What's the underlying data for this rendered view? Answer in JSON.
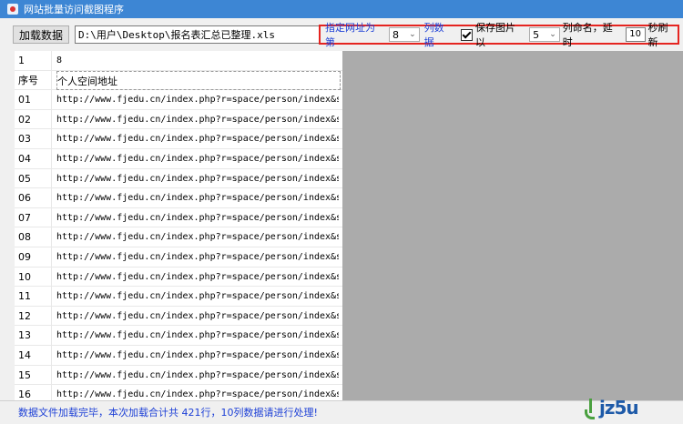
{
  "window": {
    "title": "网站批量访问截图程序"
  },
  "toolbar": {
    "load_button": "加载数据",
    "path_value": "D:\\用户\\Desktop\\报名表汇总已整理.xls"
  },
  "options": {
    "specify_label": "指定网址为第",
    "column_select": "8",
    "column_label": "列数据",
    "save_checkbox_label": "保存图片以",
    "name_select": "5",
    "name_label": "列命名，延时",
    "delay_value": "10",
    "refresh_label": "秒刷新"
  },
  "grid": {
    "top_row": [
      "1",
      "8"
    ],
    "headers": [
      "序号",
      "个人空间地址"
    ],
    "rows": [
      [
        "01",
        "http://www.fjedu.cn/index.php?r=space/person/index&sid..."
      ],
      [
        "02",
        "http://www.fjedu.cn/index.php?r=space/person/index&sid..."
      ],
      [
        "03",
        "http://www.fjedu.cn/index.php?r=space/person/index&sid..."
      ],
      [
        "04",
        "http://www.fjedu.cn/index.php?r=space/person/index&sid..."
      ],
      [
        "05",
        "http://www.fjedu.cn/index.php?r=space/person/index&sid..."
      ],
      [
        "06",
        "http://www.fjedu.cn/index.php?r=space/person/index&sid..."
      ],
      [
        "07",
        "http://www.fjedu.cn/index.php?r=space/person/index&sid..."
      ],
      [
        "08",
        "http://www.fjedu.cn/index.php?r=space/person/index&sid..."
      ],
      [
        "09",
        "http://www.fjedu.cn/index.php?r=space/person/index&sid..."
      ],
      [
        "10",
        "http://www.fjedu.cn/index.php?r=space/person/index&sid..."
      ],
      [
        "11",
        "http://www.fjedu.cn/index.php?r=space/person/index&sid..."
      ],
      [
        "12",
        "http://www.fjedu.cn/index.php?r=space/person/index&sid..."
      ],
      [
        "13",
        "http://www.fjedu.cn/index.php?r=space/person/index&sid..."
      ],
      [
        "14",
        "http://www.fjedu.cn/index.php?r=space/person/index&sid..."
      ],
      [
        "15",
        "http://www.fjedu.cn/index.php?r=space/person/index&sid..."
      ],
      [
        "16",
        "http://www.fjedu.cn/index.php?r=space/person/index&sid..."
      ]
    ]
  },
  "status": {
    "text": "数据文件加载完毕，本次加载合计共 421行，10列数据请进行处理!"
  },
  "logo": {
    "text": "jz5u"
  },
  "colors": {
    "title_bar": "#3d86d4",
    "highlight_border": "#e52420",
    "blue_text": "#1c3fd6",
    "logo_green": "#4aa03f",
    "logo_blue": "#1e5aa8"
  }
}
